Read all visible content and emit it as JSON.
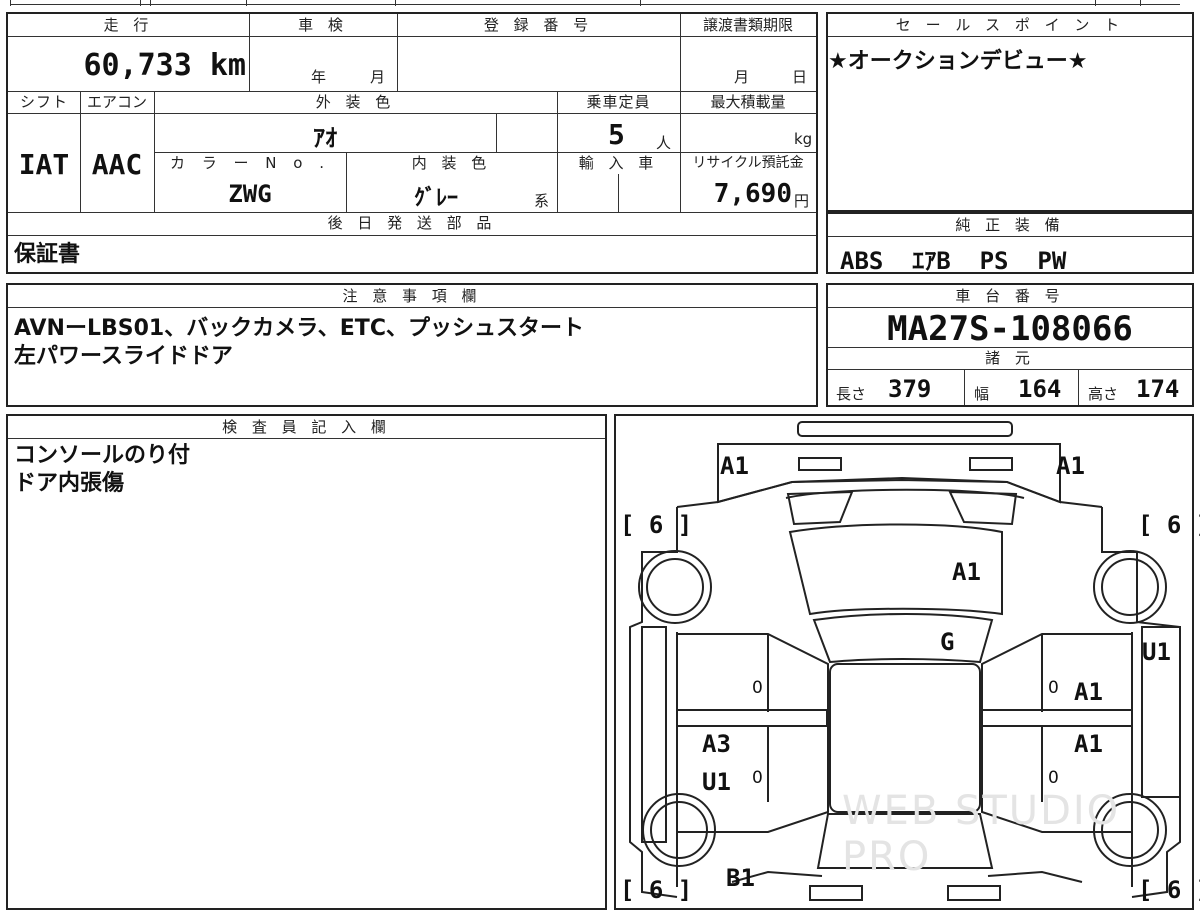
{
  "headers": {
    "mileage": "走 行",
    "inspection": "車 検",
    "registration": "登 録 番 号",
    "transfer_deadline": "譲渡書類期限",
    "sales_point": "セ ー ル ス ポ イ ン ト",
    "shift": "シフト",
    "aircon": "エアコン",
    "exterior_color": "外 装 色",
    "capacity": "乗車定員",
    "max_load": "最大積載量",
    "color_no": "カ ラ ー N o .",
    "interior_color": "内 装 色",
    "import": "輸 入 車",
    "recycle": "リサイクル預託金",
    "later_parts": "後 日 発 送 部 品",
    "equipment": "純 正 装 備",
    "notes": "注 意 事 項 欄",
    "chassis": "車 台 番 号",
    "specs": "諸 元",
    "inspector": "検 査 員 記 入 欄"
  },
  "values": {
    "mileage": "60,733 km",
    "inspection_year_unit": "年",
    "inspection_month_unit": "月",
    "deadline_month_unit": "月",
    "deadline_day_unit": "日",
    "sales_point": "★オークションデビュー★",
    "shift": "IAT",
    "aircon": "AAC",
    "exterior_color": "ｱｵ",
    "capacity": "5",
    "capacity_unit": "人",
    "max_load_unit": "kg",
    "color_no": "ZWG",
    "interior_color": "ｸﾞﾚｰ",
    "interior_suffix": "系",
    "recycle": "7,690",
    "recycle_unit": "円",
    "later_parts": "保証書",
    "equipment": "ABS  ｴｱB  PS  PW",
    "notes_line1": "AVNーLBS01、バックカメラ、ETC、プッシュスタート",
    "notes_line2": "左パワースライドドア",
    "chassis": "MA27S-108066",
    "length_label": "長さ",
    "length": "379",
    "width_label": "幅",
    "width": "164",
    "height_label": "高さ",
    "height": "174",
    "inspector_line1": "コンソールのり付",
    "inspector_line2": "ドア内張傷"
  },
  "diagram": {
    "tire_left_top": "[ 6 ]",
    "tire_right_top": "[ 6 ]",
    "tire_left_bottom": "[ 6 ]",
    "tire_right_bottom": "[ 6 ]",
    "marks": {
      "front_left": "A1",
      "front_right": "A1",
      "hood": "A1",
      "windshield": "G",
      "right_fender": "U1",
      "right_front_door": "A1",
      "right_rear_door": "A1",
      "left_rear_door_1": "A3",
      "left_rear_door_2": "U1",
      "rear_left": "B1"
    },
    "zero": "0",
    "watermark": "WEB STUDIO PRO"
  }
}
